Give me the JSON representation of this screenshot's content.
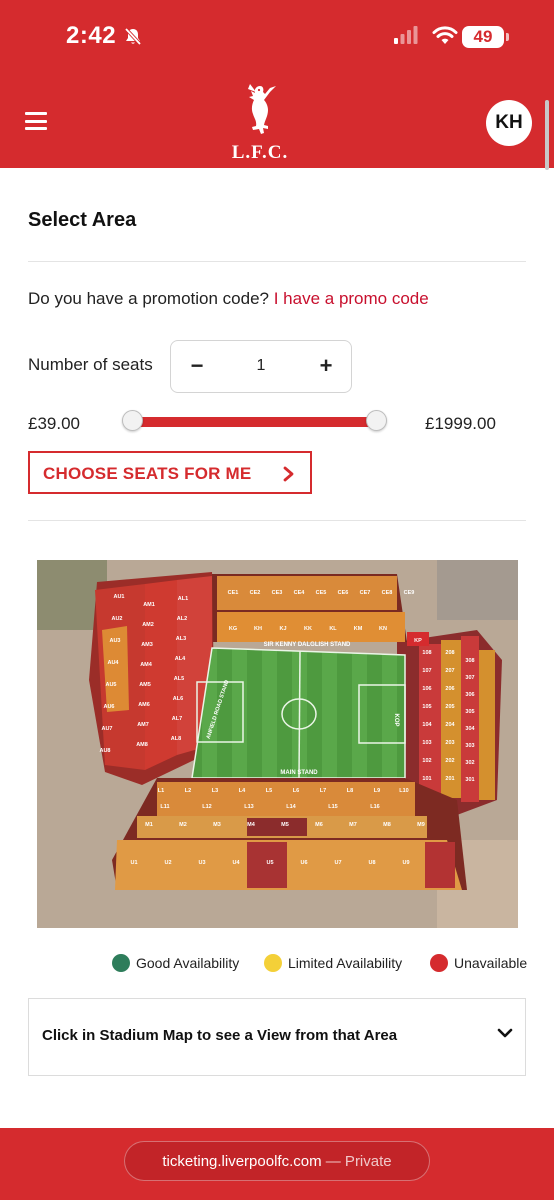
{
  "status_bar": {
    "time": "2:42",
    "battery": "49"
  },
  "header": {
    "logo_text": "L.F.C.",
    "avatar_initials": "KH"
  },
  "page": {
    "title": "Select Area"
  },
  "promo": {
    "question": "Do you have a promotion code?",
    "link": "I have a promo code"
  },
  "seats": {
    "label": "Number of seats",
    "minus": "−",
    "plus": "+",
    "value": "1"
  },
  "price": {
    "min": "£39.00",
    "max": "£1999.00",
    "range_fraction_low": 0.0,
    "range_fraction_high": 1.0
  },
  "choose_button": {
    "label": "CHOOSE SEATS FOR ME"
  },
  "stadium_map": {
    "stands": {
      "kd": "SIR KENNY DALGLISH STAND",
      "main": "MAIN STAND",
      "anfield_road": "ANFIELD ROAD STAND",
      "kop": "KOP"
    },
    "sections": [
      "CE1",
      "CE2",
      "CE3",
      "CE4",
      "CE5",
      "CE6",
      "CE7",
      "CE8",
      "CE9",
      "KG",
      "KH",
      "KJ",
      "KK",
      "KL",
      "KM",
      "KN",
      "KP",
      "AU1",
      "AU2",
      "AU3",
      "AU4",
      "AU5",
      "AU6",
      "AU7",
      "AU8",
      "AL1",
      "AL2",
      "AL3",
      "AL4",
      "AL5",
      "AL6",
      "AL7",
      "AL8",
      "AM1",
      "AM2",
      "AM3",
      "AM4",
      "AM5",
      "AM6",
      "AM7",
      "AM8",
      "101",
      "102",
      "103",
      "104",
      "105",
      "106",
      "107",
      "108",
      "201",
      "202",
      "203",
      "204",
      "205",
      "206",
      "207",
      "208",
      "301",
      "302",
      "303",
      "304",
      "305",
      "306",
      "307",
      "308",
      "L1",
      "L2",
      "L3",
      "L4",
      "L5",
      "L6",
      "L7",
      "L8",
      "L9",
      "L10",
      "L11",
      "L12",
      "L13",
      "L14",
      "L15",
      "L16",
      "M1",
      "M2",
      "M3",
      "M4",
      "M5",
      "M6",
      "M7",
      "M8",
      "M9",
      "U1",
      "U2",
      "U3",
      "U4",
      "U5",
      "U6",
      "U7",
      "U8",
      "U9"
    ]
  },
  "legend": [
    {
      "label": "Good Availability",
      "color": "#2e7d5b"
    },
    {
      "label": "Limited Availability",
      "color": "#f4d038"
    },
    {
      "label": "Unavailable",
      "color": "#d52b2e"
    }
  ],
  "view_box": {
    "label": "Click in Stadium Map to see a View from that Area"
  },
  "browser": {
    "url": "ticketing.liverpoolfc.com",
    "mode": "— Private"
  },
  "colors": {
    "brand_red": "#d52b2e",
    "link_red": "#c8102e"
  }
}
